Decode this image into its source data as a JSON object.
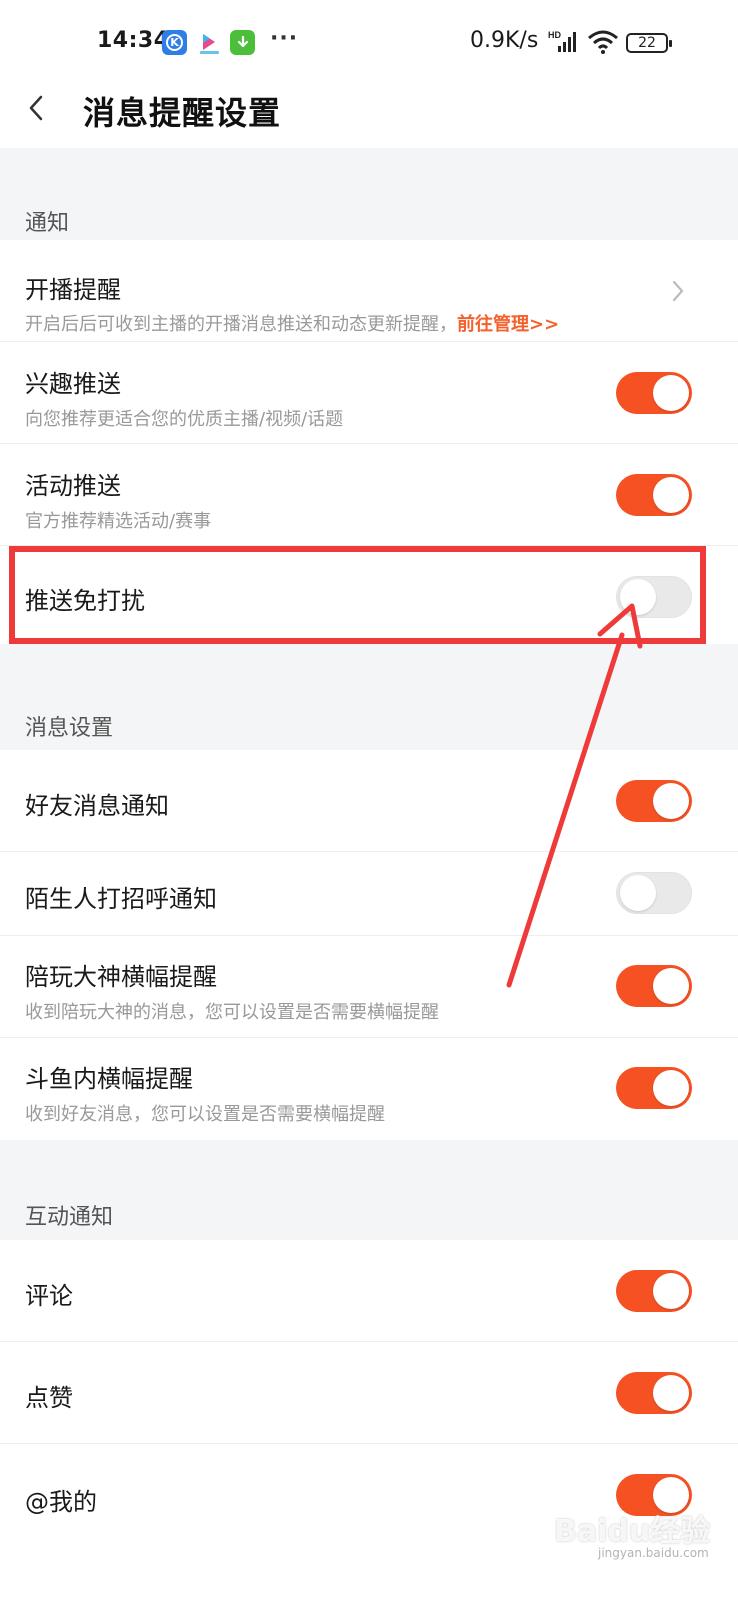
{
  "status_bar": {
    "time": "14:34",
    "network_speed": "0.9K/s",
    "signal_label": "HD",
    "battery": "22",
    "more_indicator": "···",
    "app_icons": [
      "k-app-icon",
      "bili-app-icon",
      "download-app-icon"
    ]
  },
  "nav": {
    "title": "消息提醒设置",
    "back_icon": "chevron-left-icon"
  },
  "sections": [
    {
      "label": "通知",
      "items": [
        {
          "title": "开播提醒",
          "subtitle": "开启后后可收到主播的开播消息推送和动态更新提醒，",
          "link": "前往管理>>",
          "control": "chevron"
        },
        {
          "title": "兴趣推送",
          "subtitle": "向您推荐更适合您的优质主播/视频/话题",
          "control": "toggle",
          "on": true
        },
        {
          "title": "活动推送",
          "subtitle": "官方推荐精选活动/赛事",
          "control": "toggle",
          "on": true
        },
        {
          "title": "推送免打扰",
          "control": "toggle",
          "on": false
        }
      ]
    },
    {
      "label": "消息设置",
      "items": [
        {
          "title": "好友消息通知",
          "control": "toggle",
          "on": true
        },
        {
          "title": "陌生人打招呼通知",
          "control": "toggle",
          "on": false
        },
        {
          "title": "陪玩大神横幅提醒",
          "subtitle": "收到陪玩大神的消息，您可以设置是否需要横幅提醒",
          "control": "toggle",
          "on": true
        },
        {
          "title": "斗鱼内横幅提醒",
          "subtitle": "收到好友消息，您可以设置是否需要横幅提醒",
          "control": "toggle",
          "on": true
        }
      ]
    },
    {
      "label": "互动通知",
      "items": [
        {
          "title": "评论",
          "control": "toggle",
          "on": true
        },
        {
          "title": "点赞",
          "control": "toggle",
          "on": true
        },
        {
          "title": "@我的",
          "control": "toggle",
          "on": true
        }
      ]
    }
  ],
  "colors": {
    "accent": "#f55123",
    "link": "#f5612c",
    "annotation": "#ef3a3a",
    "toggle_off": "#e9e9ea",
    "background": "#f4f5f7"
  },
  "watermark": {
    "text": "Baidu经验",
    "sub": "jingyan.baidu.com"
  }
}
